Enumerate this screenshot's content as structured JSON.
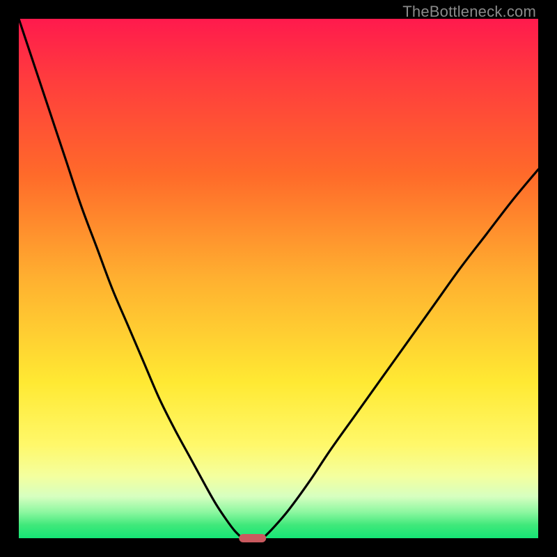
{
  "watermark": "TheBottleneck.com",
  "colors": {
    "frame": "#000000",
    "curve": "#000000",
    "marker": "#c95a5f",
    "gradient_top": "#ff1a4d",
    "gradient_bottom": "#15e676"
  },
  "chart_data": {
    "type": "line",
    "title": "",
    "xlabel": "",
    "ylabel": "",
    "xlim": [
      0,
      100
    ],
    "ylim": [
      0,
      100
    ],
    "series": [
      {
        "name": "left-curve",
        "x": [
          0,
          3,
          6,
          9,
          12,
          15,
          18,
          21,
          24,
          27,
          30,
          33,
          36,
          38,
          40,
          41.5,
          43
        ],
        "values": [
          100,
          91,
          82,
          73,
          64,
          56,
          48,
          41,
          34,
          27,
          21,
          15.5,
          10,
          6.5,
          3.5,
          1.5,
          0
        ]
      },
      {
        "name": "right-curve",
        "x": [
          47,
          49,
          52,
          56,
          60,
          65,
          70,
          75,
          80,
          85,
          90,
          95,
          100
        ],
        "values": [
          0,
          2,
          5.5,
          11,
          17,
          24,
          31,
          38,
          45,
          52,
          58.5,
          65,
          71
        ]
      }
    ],
    "marker": {
      "x": 45,
      "y": 0,
      "width_frac": 0.053
    },
    "grid": false,
    "legend": false
  }
}
